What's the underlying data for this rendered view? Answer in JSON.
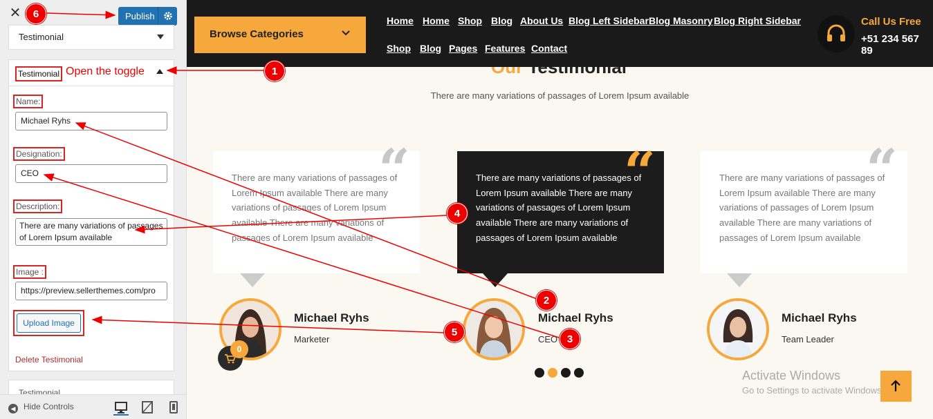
{
  "sidebar": {
    "publish_label": "Publish",
    "top_panel": "Testimonial",
    "section_title": "Testimonial",
    "toggle_note": "Open the toggle",
    "fields": {
      "name_label": "Name:",
      "name_value": "Michael Ryhs",
      "designation_label": "Designation:",
      "designation_value": "CEO",
      "description_label": "Description:",
      "description_value": "There are many variations of passages of Lorem Ipsum available",
      "image_label": "Image :",
      "image_value": "https://preview.sellerthemes.com/pro"
    },
    "upload_label": "Upload Image",
    "delete_label": "Delete Testimonial",
    "bottom_panel": "Testimonial",
    "hide_controls": "Hide Controls"
  },
  "preview": {
    "browse_label": "Browse Categories",
    "nav_row1": [
      "Home",
      "Home",
      "Shop",
      "Blog",
      "About Us",
      "Blog Left Sidebar",
      "Blog Masonry",
      "Blog Right Sidebar"
    ],
    "nav_row2": [
      "Shop",
      "Blog",
      "Pages",
      "Features",
      "Contact"
    ],
    "call_label": "Call Us Free",
    "call_number": "+51 234 567 89",
    "heading_highlight": "Our",
    "heading_rest": "Testimonial",
    "subheading": "There are many variations of passages of Lorem Ipsum available",
    "testimonials": [
      {
        "text": "There are many variations of passages of Lorem Ipsum available There are many variations of passages of Lorem Ipsum available There are many variations of passages of Lorem Ipsum available",
        "name": "Michael Ryhs",
        "role": "Marketer"
      },
      {
        "text": "There are many variations of passages of Lorem Ipsum available There are many variations of passages of Lorem Ipsum available There are many variations of passages of Lorem Ipsum available",
        "name": "Michael Ryhs",
        "role": "CEO"
      },
      {
        "text": "There are many variations of passages of Lorem Ipsum available There are many variations of passages of Lorem Ipsum available There are many variations of passages of Lorem Ipsum available",
        "name": "Michael Ryhs",
        "role": "Team Leader"
      }
    ],
    "cart_count": "0",
    "active_dot": 2,
    "watermark_title": "Activate Windows",
    "watermark_sub": "Go to Settings to activate Windows."
  },
  "annotations": [
    "1",
    "2",
    "3",
    "4",
    "5",
    "6"
  ],
  "colors": {
    "accent": "#f6a83d",
    "dark": "#1a1a1a",
    "annotation": "#e00000",
    "publish": "#2271b1"
  }
}
